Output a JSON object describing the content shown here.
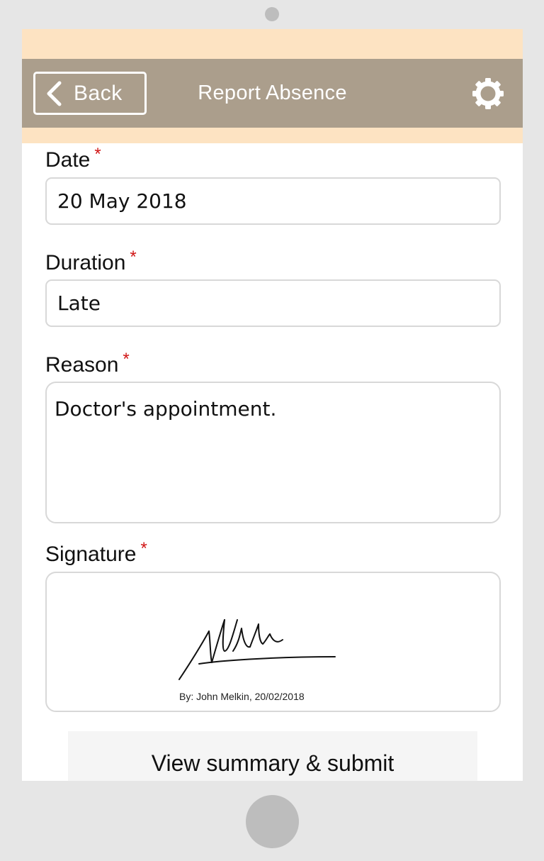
{
  "header": {
    "back_label": "Back",
    "title": "Report Absence",
    "settings_icon": "gear-icon"
  },
  "form": {
    "required_marker": "*",
    "date": {
      "label": "Date",
      "value": "20 May 2018"
    },
    "duration": {
      "label": "Duration",
      "value": "Late"
    },
    "reason": {
      "label": "Reason",
      "value": "Doctor's appointment."
    },
    "signature": {
      "label": "Signature",
      "caption": "By: John Melkin, 20/02/2018",
      "signature_text": "Melkin"
    }
  },
  "submit_label": "View summary & submit",
  "colors": {
    "header_bg": "#ab9e8c",
    "accent_strip": "#fde3c2",
    "required": "#d01515",
    "device_frame": "#e6e6e6"
  }
}
